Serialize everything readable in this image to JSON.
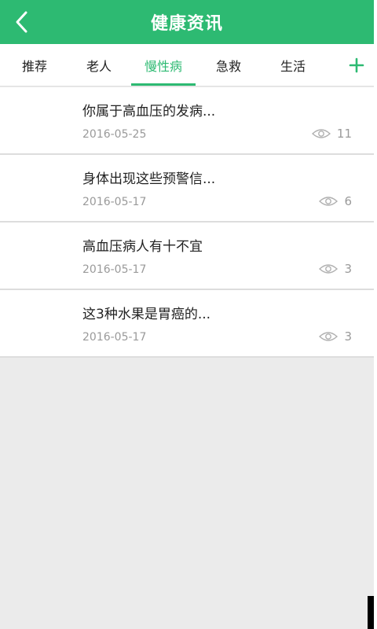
{
  "header": {
    "title": "健康资讯",
    "back_icon": "chevron-left-icon",
    "background_color": "#2dba72"
  },
  "tabs": [
    {
      "label": "推荐",
      "active": false
    },
    {
      "label": "老人",
      "active": false
    },
    {
      "label": "慢性病",
      "active": true
    },
    {
      "label": "急救",
      "active": false
    },
    {
      "label": "生活",
      "active": false
    }
  ],
  "add_button": {
    "icon": "plus-icon",
    "color": "#2dba72"
  },
  "articles": [
    {
      "title": "你属于高血压的发病...",
      "date": "2016-05-25",
      "views": "11"
    },
    {
      "title": "身体出现这些预警信...",
      "date": "2016-05-17",
      "views": "6"
    },
    {
      "title": "高血压病人有十不宜",
      "date": "2016-05-17",
      "views": "3"
    },
    {
      "title": "这3种水果是胃癌的...",
      "date": "2016-05-17",
      "views": "3"
    }
  ]
}
